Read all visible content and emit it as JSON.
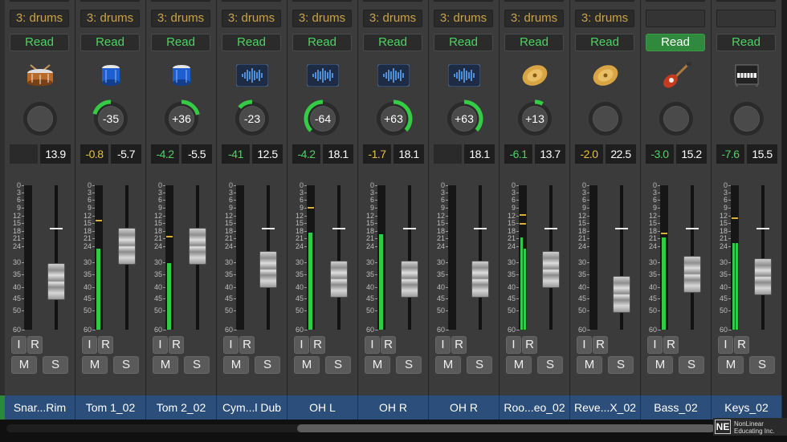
{
  "colors": {
    "accent_green": "#2ecc4a",
    "group_text": "#c9a24a",
    "name_bar": "#2c4e7a",
    "pan_arc": "#33cc44"
  },
  "scale_labels": [
    "0",
    "3",
    "6",
    "9",
    "12",
    "15",
    "18",
    "21",
    "24",
    "30",
    "35",
    "40",
    "45",
    "50",
    "60"
  ],
  "button_labels": {
    "input": "I",
    "record": "R",
    "mute": "M",
    "solo": "S"
  },
  "watermark": {
    "line1": "NonLinear",
    "line2": "Educating Inc.",
    "logo": "NE"
  },
  "strips": [
    {
      "group": "3: drums",
      "automation": "Read",
      "automation_active": false,
      "icon": "snare-drum-icon",
      "pan": "",
      "pan_value": 0,
      "pan_visible": false,
      "peak": "",
      "peak_color": "",
      "volume": "13.9",
      "meter": [
        0,
        0
      ],
      "peak_marks": [],
      "fader_db": "-38",
      "name": "Snar...Rim"
    },
    {
      "group": "3: drums",
      "automation": "Read",
      "automation_active": false,
      "icon": "tom-drum-icon",
      "pan": "-35",
      "pan_value": -35,
      "pan_visible": true,
      "peak": "-0.8",
      "peak_color": "#e8c040",
      "volume": "-5.7",
      "meter": [
        0.56,
        0
      ],
      "peak_marks": [
        0.76
      ],
      "fader_db": "-24",
      "name": "Tom 1_02"
    },
    {
      "group": "3: drums",
      "automation": "Read",
      "automation_active": false,
      "icon": "tom-drum-icon",
      "pan": "+36",
      "pan_value": 36,
      "pan_visible": true,
      "peak": "-4.2",
      "peak_color": "#4fd264",
      "volume": "-5.5",
      "meter": [
        0.46,
        0
      ],
      "peak_marks": [
        0.65
      ],
      "fader_db": "-24",
      "name": "Tom 2_02"
    },
    {
      "group": "3: drums",
      "automation": "Read",
      "automation_active": false,
      "icon": "waveform-icon",
      "pan": "-23",
      "pan_value": -23,
      "pan_visible": true,
      "peak": "-41",
      "peak_color": "#4fd264",
      "volume": "12.5",
      "meter": [
        0,
        0
      ],
      "peak_marks": [],
      "fader_db": "-33",
      "name": "Cym...l Dub"
    },
    {
      "group": "3: drums",
      "automation": "Read",
      "automation_active": false,
      "icon": "waveform-icon",
      "pan": "-64",
      "pan_value": -64,
      "pan_visible": true,
      "peak": "-4.2",
      "peak_color": "#4fd264",
      "volume": "18.1",
      "meter": [
        0.67,
        0
      ],
      "peak_marks": [
        0.85
      ],
      "fader_db": "-37",
      "name": "OH L"
    },
    {
      "group": "3: drums",
      "automation": "Read",
      "automation_active": false,
      "icon": "waveform-icon",
      "pan": "+63",
      "pan_value": 63,
      "pan_visible": true,
      "peak": "-1.7",
      "peak_color": "#e8c040",
      "volume": "18.1",
      "meter": [
        0.66,
        0
      ],
      "peak_marks": [],
      "fader_db": "-37",
      "name": "OH R"
    },
    {
      "group": "3: drums",
      "automation": "Read",
      "automation_active": false,
      "icon": "waveform-icon",
      "pan": "+63",
      "pan_value": 63,
      "pan_visible": true,
      "peak": "",
      "peak_color": "",
      "volume": "18.1",
      "meter": [
        0,
        0
      ],
      "peak_marks": [],
      "fader_db": "-37",
      "name": "OH R"
    },
    {
      "group": "3: drums",
      "automation": "Read",
      "automation_active": false,
      "icon": "cymbal-icon",
      "pan": "+13",
      "pan_value": 13,
      "pan_visible": true,
      "peak": "-6.1",
      "peak_color": "#4fd264",
      "volume": "13.7",
      "meter": [
        0.64,
        0.56
      ],
      "peak_marks": [
        0.8,
        0.74
      ],
      "fader_db": "-33",
      "name": "Roo...eo_02"
    },
    {
      "group": "3: drums",
      "automation": "Read",
      "automation_active": false,
      "icon": "cymbal-icon",
      "pan": "",
      "pan_value": 0,
      "pan_visible": false,
      "peak": "-2.0",
      "peak_color": "#e8c040",
      "volume": "22.5",
      "meter": [
        0,
        0
      ],
      "peak_marks": [],
      "fader_db": "-43",
      "name": "Reve...X_02"
    },
    {
      "group": "",
      "automation": "Read",
      "automation_active": true,
      "icon": "electric-guitar-icon",
      "pan": "",
      "pan_value": 0,
      "pan_visible": false,
      "peak": "-3.0",
      "peak_color": "#4fd264",
      "volume": "15.2",
      "meter": [
        0.64,
        0
      ],
      "peak_marks": [
        0.67
      ],
      "fader_db": "-35",
      "name": "Bass_02"
    },
    {
      "group": "",
      "automation": "Read",
      "automation_active": false,
      "icon": "piano-icon",
      "pan": "",
      "pan_value": 0,
      "pan_visible": false,
      "peak": "-7.6",
      "peak_color": "#4fd264",
      "volume": "15.5",
      "meter": [
        0.6,
        0.6
      ],
      "peak_marks": [
        0.78,
        0.78
      ],
      "fader_db": "-36",
      "name": "Keys_02"
    }
  ]
}
